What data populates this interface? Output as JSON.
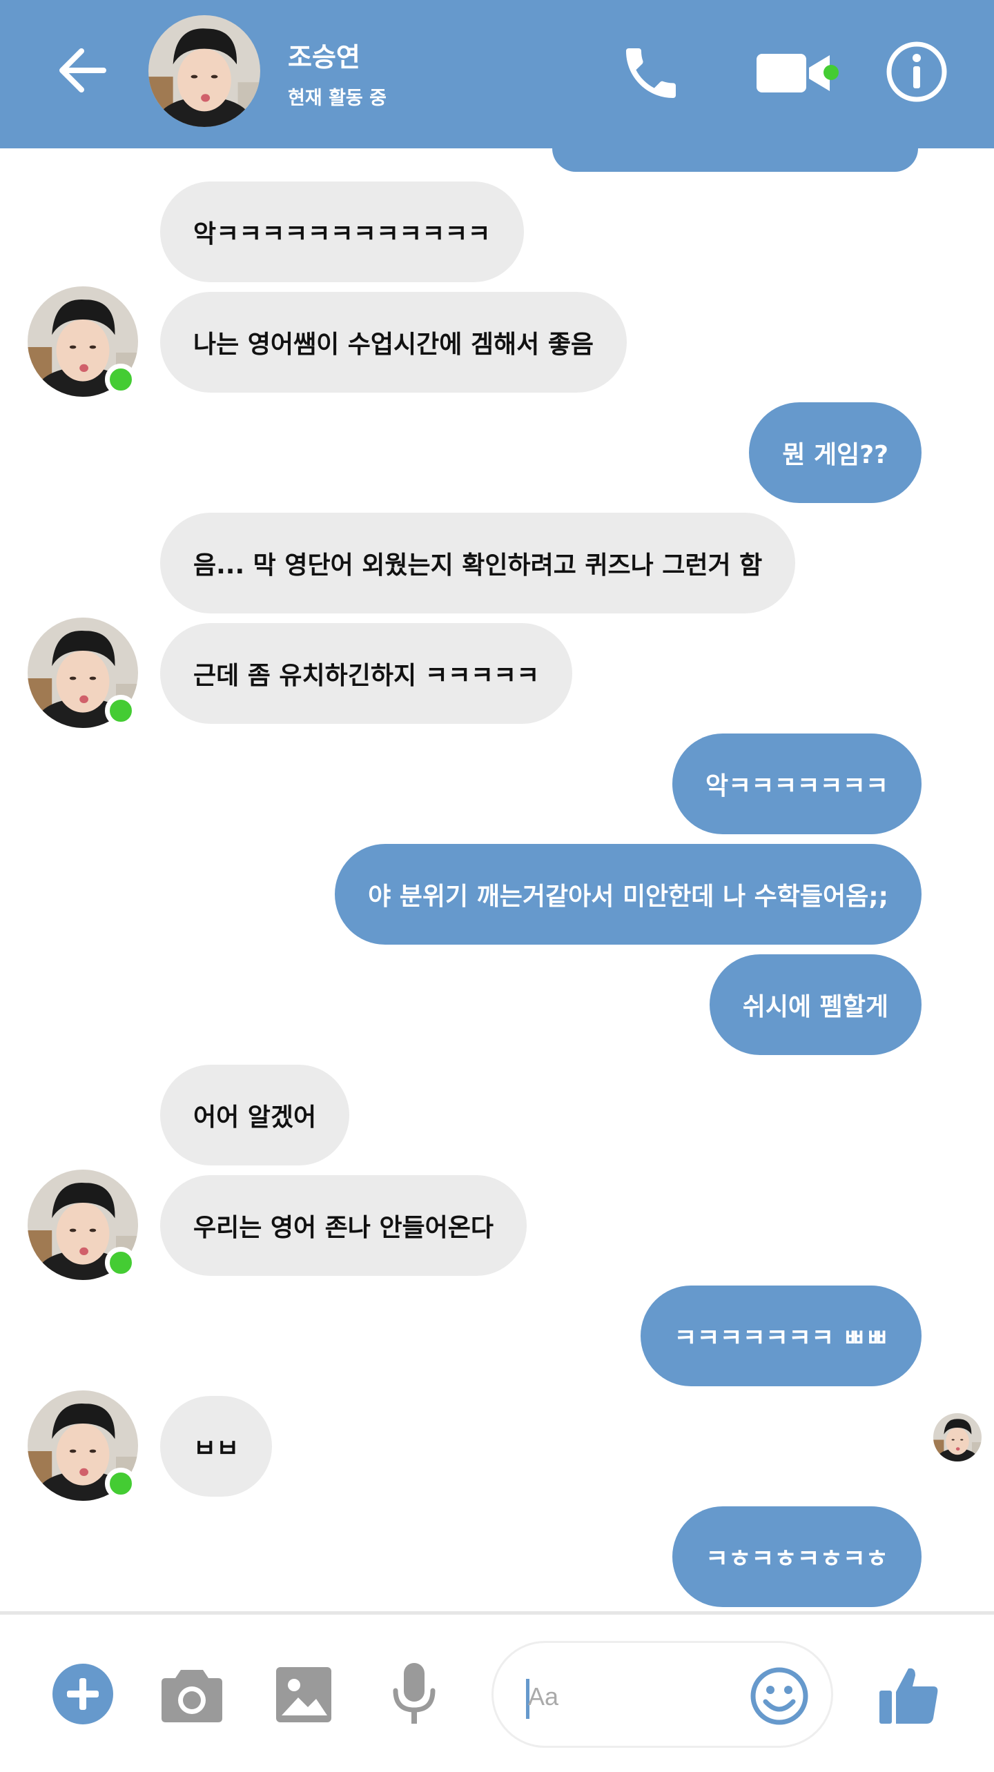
{
  "header": {
    "contact_name": "조승연",
    "status": "현재 활동 중"
  },
  "colors": {
    "accent": "#6699cc",
    "incoming_bubble": "#ebebeb",
    "online": "#44cc33"
  },
  "messages": [
    {
      "dir": "in",
      "text": "악ㅋㅋㅋㅋㅋㅋㅋㅋㅋㅋㅋㅋ"
    },
    {
      "dir": "in",
      "text": "나는 영어쌤이 수업시간에 겜해서 좋음"
    },
    {
      "dir": "out",
      "text": "뭔 게임??"
    },
    {
      "dir": "in",
      "text": "음... 막 영단어 외웠는지 확인하려고 퀴즈나 그런거 함"
    },
    {
      "dir": "in",
      "text": "근데 좀 유치하긴하지 ㅋㅋㅋㅋㅋ"
    },
    {
      "dir": "out",
      "text": "악ㅋㅋㅋㅋㅋㅋㅋ"
    },
    {
      "dir": "out",
      "text": "야 분위기 깨는거같아서 미안한데 나 수학들어옴;;"
    },
    {
      "dir": "out",
      "text": "쉬시에 펨할게"
    },
    {
      "dir": "in",
      "text": "어어 알겠어"
    },
    {
      "dir": "in",
      "text": "우리는 영어 존나 안들어온다"
    },
    {
      "dir": "out",
      "text": "ㅋㅋㅋㅋㅋㅋㅋ ㅃㅃ"
    },
    {
      "dir": "in",
      "text": "ㅂㅂ"
    },
    {
      "dir": "out",
      "text": "ㅋㅎㅋㅎㅋㅎㅋㅎ"
    }
  ],
  "composer": {
    "placeholder": "Aa"
  },
  "icons": {
    "back": "back-arrow-icon",
    "call": "phone-icon",
    "video": "video-camera-icon",
    "info": "info-icon",
    "plus": "plus-icon",
    "camera": "camera-icon",
    "gallery": "image-icon",
    "mic": "microphone-icon",
    "emoji": "smiley-icon",
    "like": "thumbs-up-icon"
  }
}
